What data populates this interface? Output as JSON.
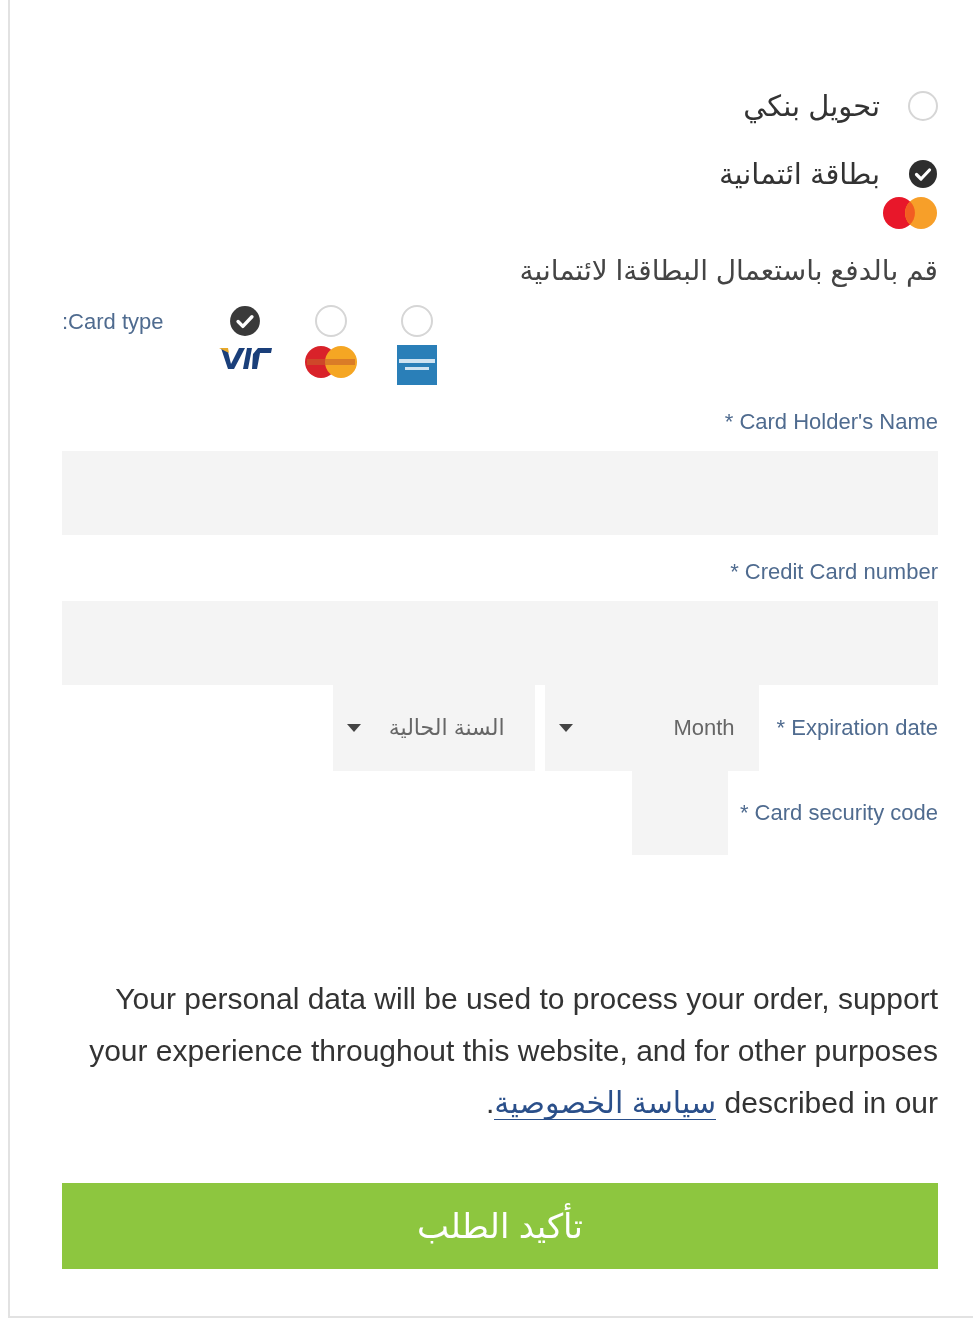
{
  "payment_methods": [
    {
      "label": "تحويل بنكي",
      "selected": false
    },
    {
      "label": "بطاقة ائتمانية",
      "selected": true
    }
  ],
  "description": "قم بالدفع باستعمال البطاقةا لائتمانية",
  "card_type": {
    "label": ":Card type",
    "options": [
      {
        "kind": "visa",
        "selected": true
      },
      {
        "kind": "mastercard",
        "selected": false
      },
      {
        "kind": "amex",
        "selected": false
      }
    ]
  },
  "fields": [
    {
      "label": "* Card Holder's Name"
    },
    {
      "label": "* Credit Card number"
    }
  ],
  "expiration": {
    "label": "* Expiration date",
    "month": "Month",
    "year": "السنة الحالية"
  },
  "security_code": {
    "label": "* Card security code"
  },
  "privacy": {
    "text": "Your personal data will be used to process your order, support your experience throughout this website, and for other purposes described in our",
    "link": "سياسة الخصوصية",
    "after": "."
  },
  "submit": "تأكيد الطلب"
}
